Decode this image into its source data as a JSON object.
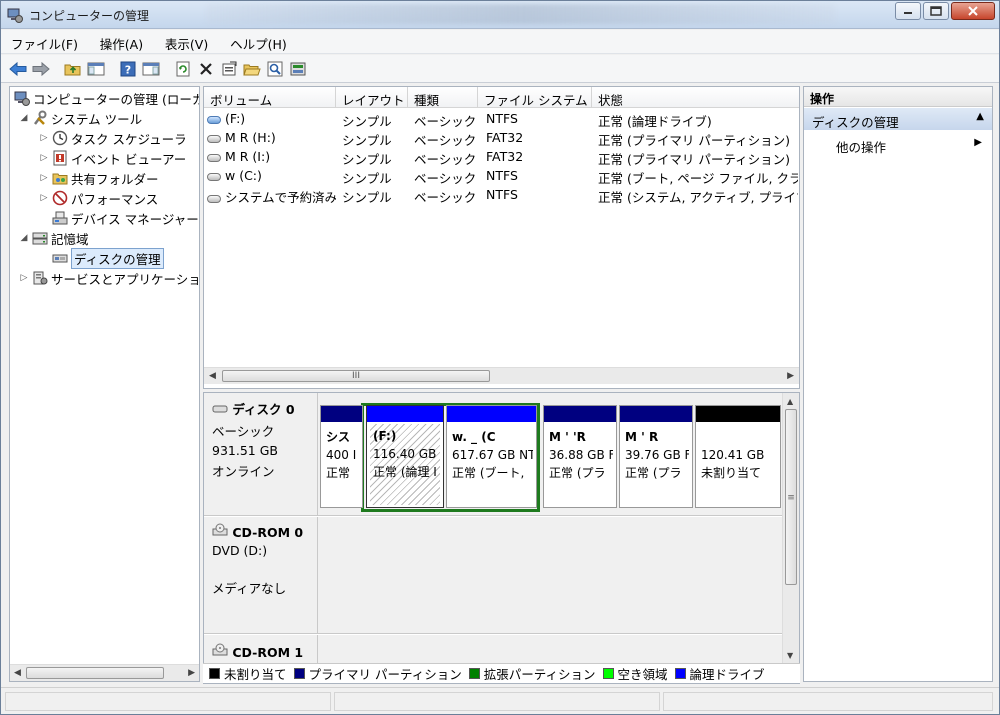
{
  "window": {
    "title": "コンピューターの管理"
  },
  "menu": [
    {
      "label": "ファイル(F)"
    },
    {
      "label": "操作(A)"
    },
    {
      "label": "表示(V)"
    },
    {
      "label": "ヘルプ(H)"
    }
  ],
  "tree": {
    "root": "コンピューターの管理 (ローカ",
    "system_tools": "システム ツール",
    "task_scheduler": "タスク スケジューラ",
    "event_viewer": "イベント ビューアー",
    "shared_folders": "共有フォルダー",
    "performance": "パフォーマンス",
    "device_manager": "デバイス マネージャー",
    "storage": "記憶域",
    "disk_management": "ディスクの管理",
    "services": "サービスとアプリケーショ"
  },
  "volume_list": {
    "headers": [
      "ボリューム",
      "レイアウト",
      "種類",
      "ファイル システム",
      "状態"
    ],
    "rows": [
      {
        "volume": "(F:)",
        "layout": "シンプル",
        "type": "ベーシック",
        "fs": "NTFS",
        "status": "正常 (論理ドライブ)"
      },
      {
        "volume": "M      R (H:)",
        "layout": "シンプル",
        "type": "ベーシック",
        "fs": "FAT32",
        "status": "正常 (プライマリ パーティション)"
      },
      {
        "volume": "M      R (I:)",
        "layout": "シンプル",
        "type": "ベーシック",
        "fs": "FAT32",
        "status": "正常 (プライマリ パーティション)"
      },
      {
        "volume": "w      (C:)",
        "layout": "シンプル",
        "type": "ベーシック",
        "fs": "NTFS",
        "status": "正常 (ブート, ページ ファイル, クラ"
      },
      {
        "volume": "システムで予約済み",
        "layout": "シンプル",
        "type": "ベーシック",
        "fs": "NTFS",
        "status": "正常 (システム, アクティブ, プライマ"
      }
    ],
    "scroll_thumb": "III"
  },
  "disks": {
    "disk0": {
      "name": "ディスク 0",
      "type": "ベーシック",
      "size": "931.51 GB",
      "state": "オンライン"
    },
    "cdrom0": {
      "name": "CD-ROM 0",
      "drive": "DVD (D:)",
      "state": "メディアなし"
    },
    "cdrom1": {
      "name": "CD-ROM 1"
    },
    "partitions": [
      {
        "name": "シス",
        "size": "400 I",
        "status": "正常"
      },
      {
        "name": "(F:)",
        "size": "116.40 GB",
        "status": "正常 (論理 I"
      },
      {
        "name": "w.  _   (C",
        "size": "617.67 GB NT",
        "status": "正常 (ブート,"
      },
      {
        "name": "M   '   'R",
        "size": "36.88 GB F",
        "status": "正常 (プラ"
      },
      {
        "name": "M    '   R",
        "size": "39.76 GB F",
        "status": "正常 (プラ"
      },
      {
        "name": "",
        "size": "120.41 GB",
        "status": "未割り当て"
      }
    ],
    "vscroll_thumb": "≡"
  },
  "legend": [
    {
      "label": "未割り当て",
      "color": "#000000"
    },
    {
      "label": "プライマリ パーティション",
      "color": "#000080"
    },
    {
      "label": "拡張パーティション",
      "color": "#008000"
    },
    {
      "label": "空き領域",
      "color": "#00ff00"
    },
    {
      "label": "論理ドライブ",
      "color": "#0000ff"
    }
  ],
  "actions": {
    "header": "操作",
    "section": "ディスクの管理",
    "item": "他の操作"
  }
}
